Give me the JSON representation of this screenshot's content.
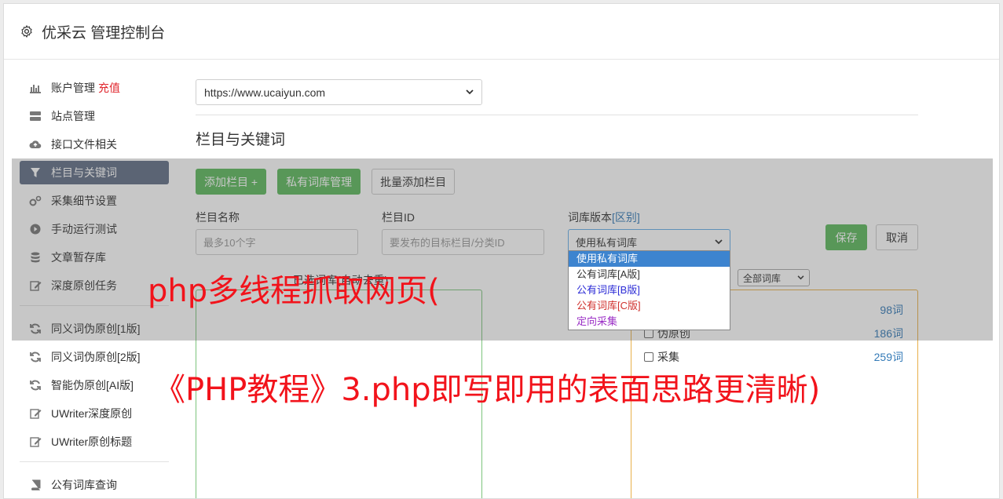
{
  "header": {
    "title": "优采云 管理控制台",
    "icon": "gear-icon"
  },
  "sidebar": {
    "items": [
      {
        "label": "账户管理",
        "badge": "充值",
        "icon": "bar-chart-icon"
      },
      {
        "label": "站点管理",
        "icon": "server-icon"
      },
      {
        "label": "接口文件相关",
        "icon": "cloud-upload-icon"
      },
      {
        "label": "栏目与关键词",
        "icon": "filter-icon",
        "active": true
      },
      {
        "label": "采集细节设置",
        "icon": "gears-icon"
      },
      {
        "label": "手动运行测试",
        "icon": "play-circle-icon"
      },
      {
        "label": "文章暂存库",
        "icon": "database-icon"
      },
      {
        "label": "深度原创任务",
        "icon": "edit-icon"
      },
      {
        "label": "同义词伪原创[1版]",
        "icon": "refresh-icon"
      },
      {
        "label": "同义词伪原创[2版]",
        "icon": "refresh-icon"
      },
      {
        "label": "智能伪原创[AI版]",
        "icon": "refresh-icon"
      },
      {
        "label": "UWriter深度原创",
        "icon": "edit-icon"
      },
      {
        "label": "UWriter原创标题",
        "icon": "edit-icon"
      },
      {
        "label": "公有词库查询",
        "icon": "book-icon"
      }
    ]
  },
  "main": {
    "site_select": {
      "value": "https://www.ucaiyun.com"
    },
    "section_title": "栏目与关键词",
    "buttons": {
      "add_column": "添加栏目 +",
      "private_lib": "私有词库管理",
      "batch_add": "批量添加栏目"
    },
    "fields": {
      "column_name": {
        "label": "栏目名称",
        "placeholder": "最多10个字"
      },
      "column_id": {
        "label": "栏目ID",
        "placeholder": "要发布的目标栏目/分类ID"
      },
      "lib_version": {
        "label": "词库版本",
        "link": "[区别]",
        "value": "使用私有词库"
      }
    },
    "save": "保存",
    "cancel": "取消",
    "dropdown_options": [
      {
        "label": "使用私有词库",
        "color": "#ffffff",
        "selected": true
      },
      {
        "label": "公有词库[A版]",
        "color": "#333333"
      },
      {
        "label": "公有词库[B版]",
        "color": "#2b2bd6"
      },
      {
        "label": "公有词库[C版]",
        "color": "#d0312d"
      },
      {
        "label": "定向采集",
        "color": "#9b2fc6"
      }
    ],
    "pane_label": "已选词库(自动去重)",
    "lib_filter": "全部词库",
    "libraries": [
      {
        "label": "",
        "count": "98词"
      },
      {
        "label": "伪原创",
        "count": "186词"
      },
      {
        "label": "采集",
        "count": "259词"
      }
    ]
  },
  "captions": {
    "line1": "php多线程抓取网页(",
    "line2": "《PHP教程》3.php即写即用的表面思路更清晰)"
  }
}
